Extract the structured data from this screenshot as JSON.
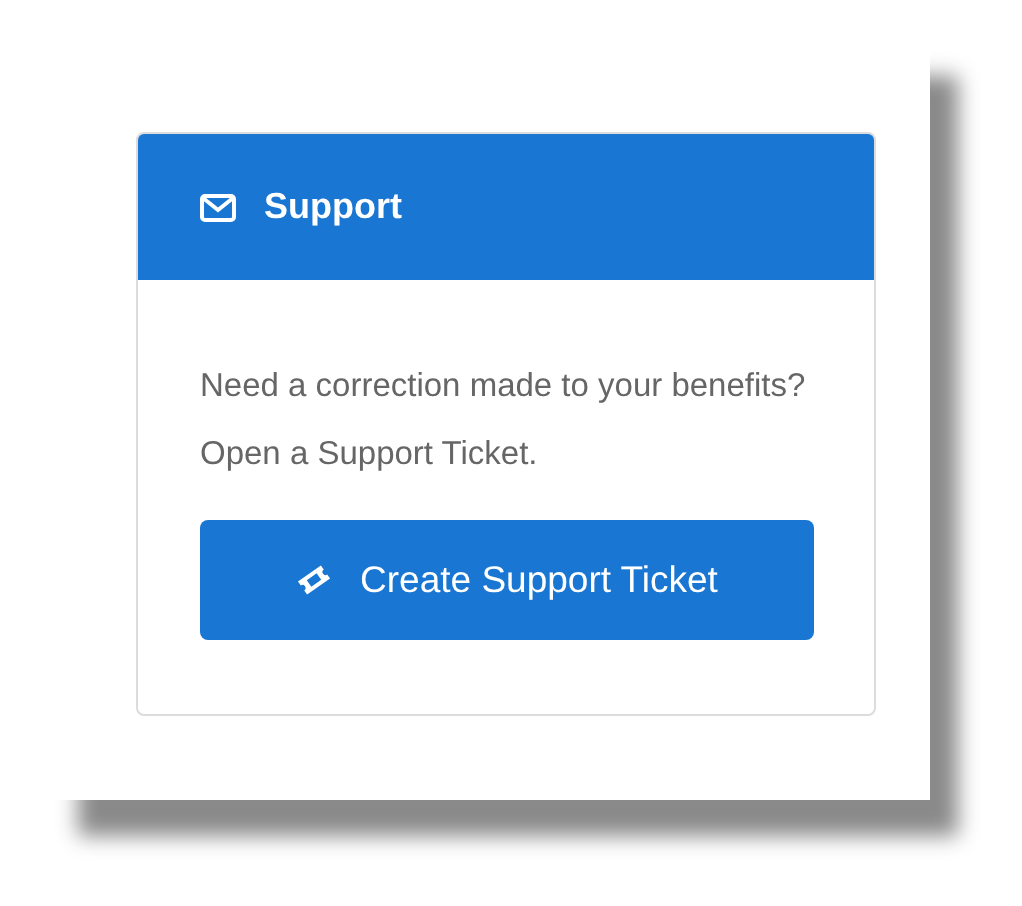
{
  "card": {
    "title": "Support",
    "text": "Need a correction made to your benefits? Open a Support Ticket.",
    "button": "Create Support Ticket"
  }
}
